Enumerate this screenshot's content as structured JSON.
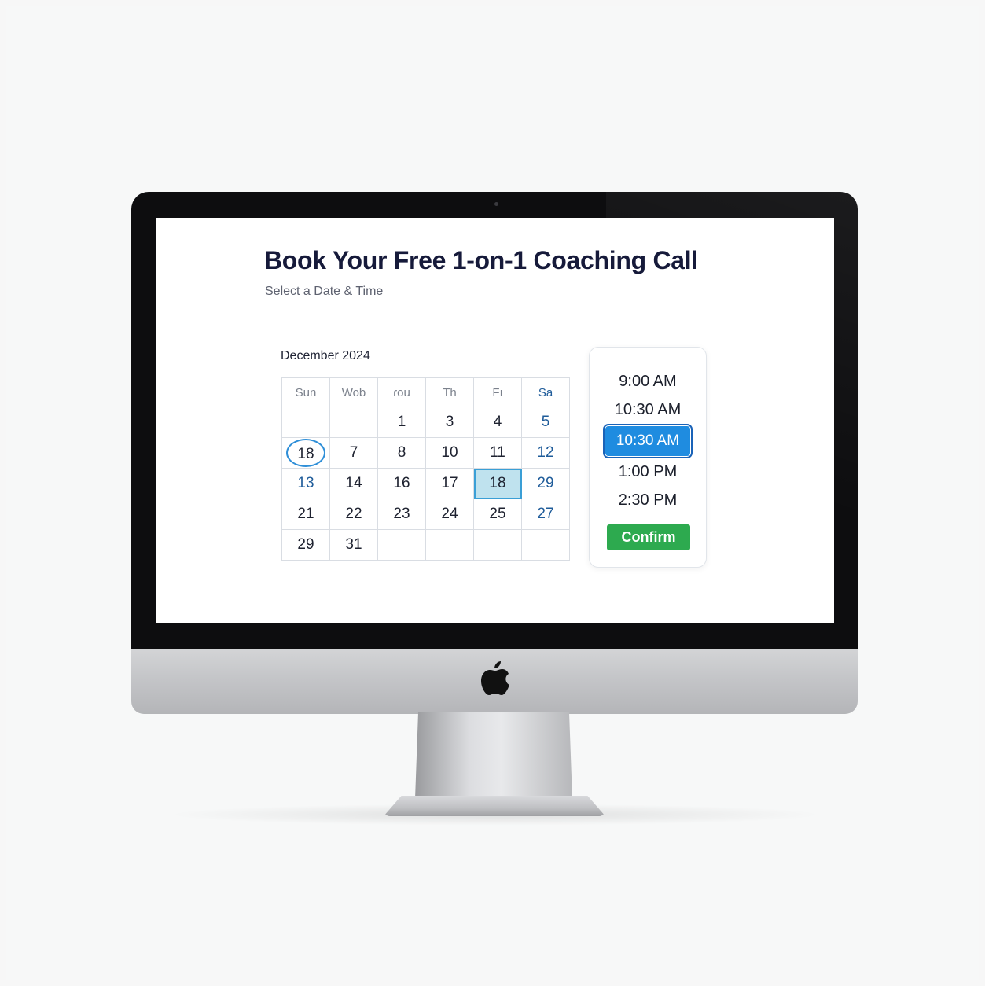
{
  "page": {
    "title": "Book Your Free 1-on-1 Coaching Call",
    "subtitle": "Select a Date & Time"
  },
  "calendar": {
    "month": "December 2024",
    "weekdays": [
      "Sun",
      "Wob",
      "ɾou",
      "Th",
      "Fı",
      "Sa"
    ],
    "rows": [
      [
        "",
        "",
        "1",
        "3",
        "4",
        "5"
      ],
      [
        "18",
        "7",
        "8",
        "10",
        "11",
        "12"
      ],
      [
        "13",
        "14",
        "16",
        "17",
        "18",
        "29"
      ],
      [
        "21",
        "22",
        "23",
        "24",
        "25",
        "27"
      ],
      [
        "29",
        "31",
        "",
        "",
        "",
        ""
      ]
    ],
    "circled_day": "18",
    "selected_day": "18"
  },
  "times": {
    "slots": [
      "9:00 AM",
      "10:30 AM",
      "10:30 AM",
      "1:00 PM",
      "2:30 PM"
    ],
    "selected_index": 2,
    "confirm_label": "Confirm"
  },
  "colors": {
    "accent": "#1f8ce0",
    "confirm": "#2daa4f",
    "selected_day_bg": "#bfe2ee",
    "weekend_text": "#1f5c9a"
  },
  "icons": [
    "apple-logo-icon"
  ]
}
